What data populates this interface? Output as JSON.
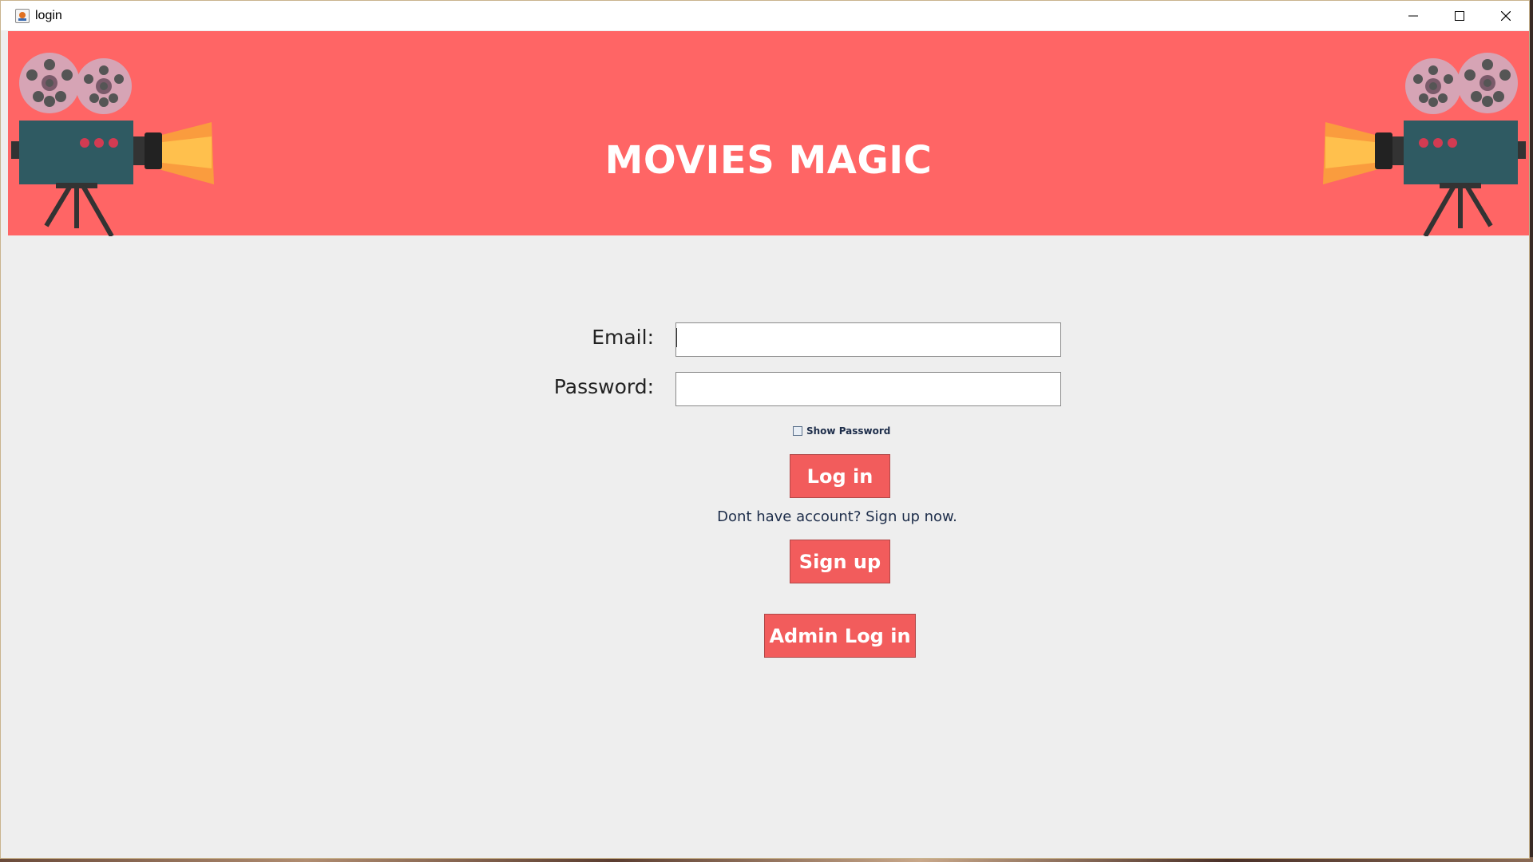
{
  "window": {
    "title": "login",
    "controls": [
      "minimize-icon",
      "maximize-icon",
      "close-icon"
    ]
  },
  "banner": {
    "title": "MOVIES MAGIC",
    "background": "#ff6565",
    "decor": [
      "projector-icon",
      "projector-icon"
    ]
  },
  "form": {
    "email_label": "Email:",
    "email_value": "",
    "password_label": "Password:",
    "password_value": "",
    "show_password_label": "Show Password",
    "show_password_checked": false
  },
  "actions": {
    "login_label": "Log in",
    "signup_prompt": "Dont have account? Sign up now.",
    "signup_label": "Sign up",
    "admin_login_label": "Admin Log in",
    "button_color": "#f25c5c"
  }
}
